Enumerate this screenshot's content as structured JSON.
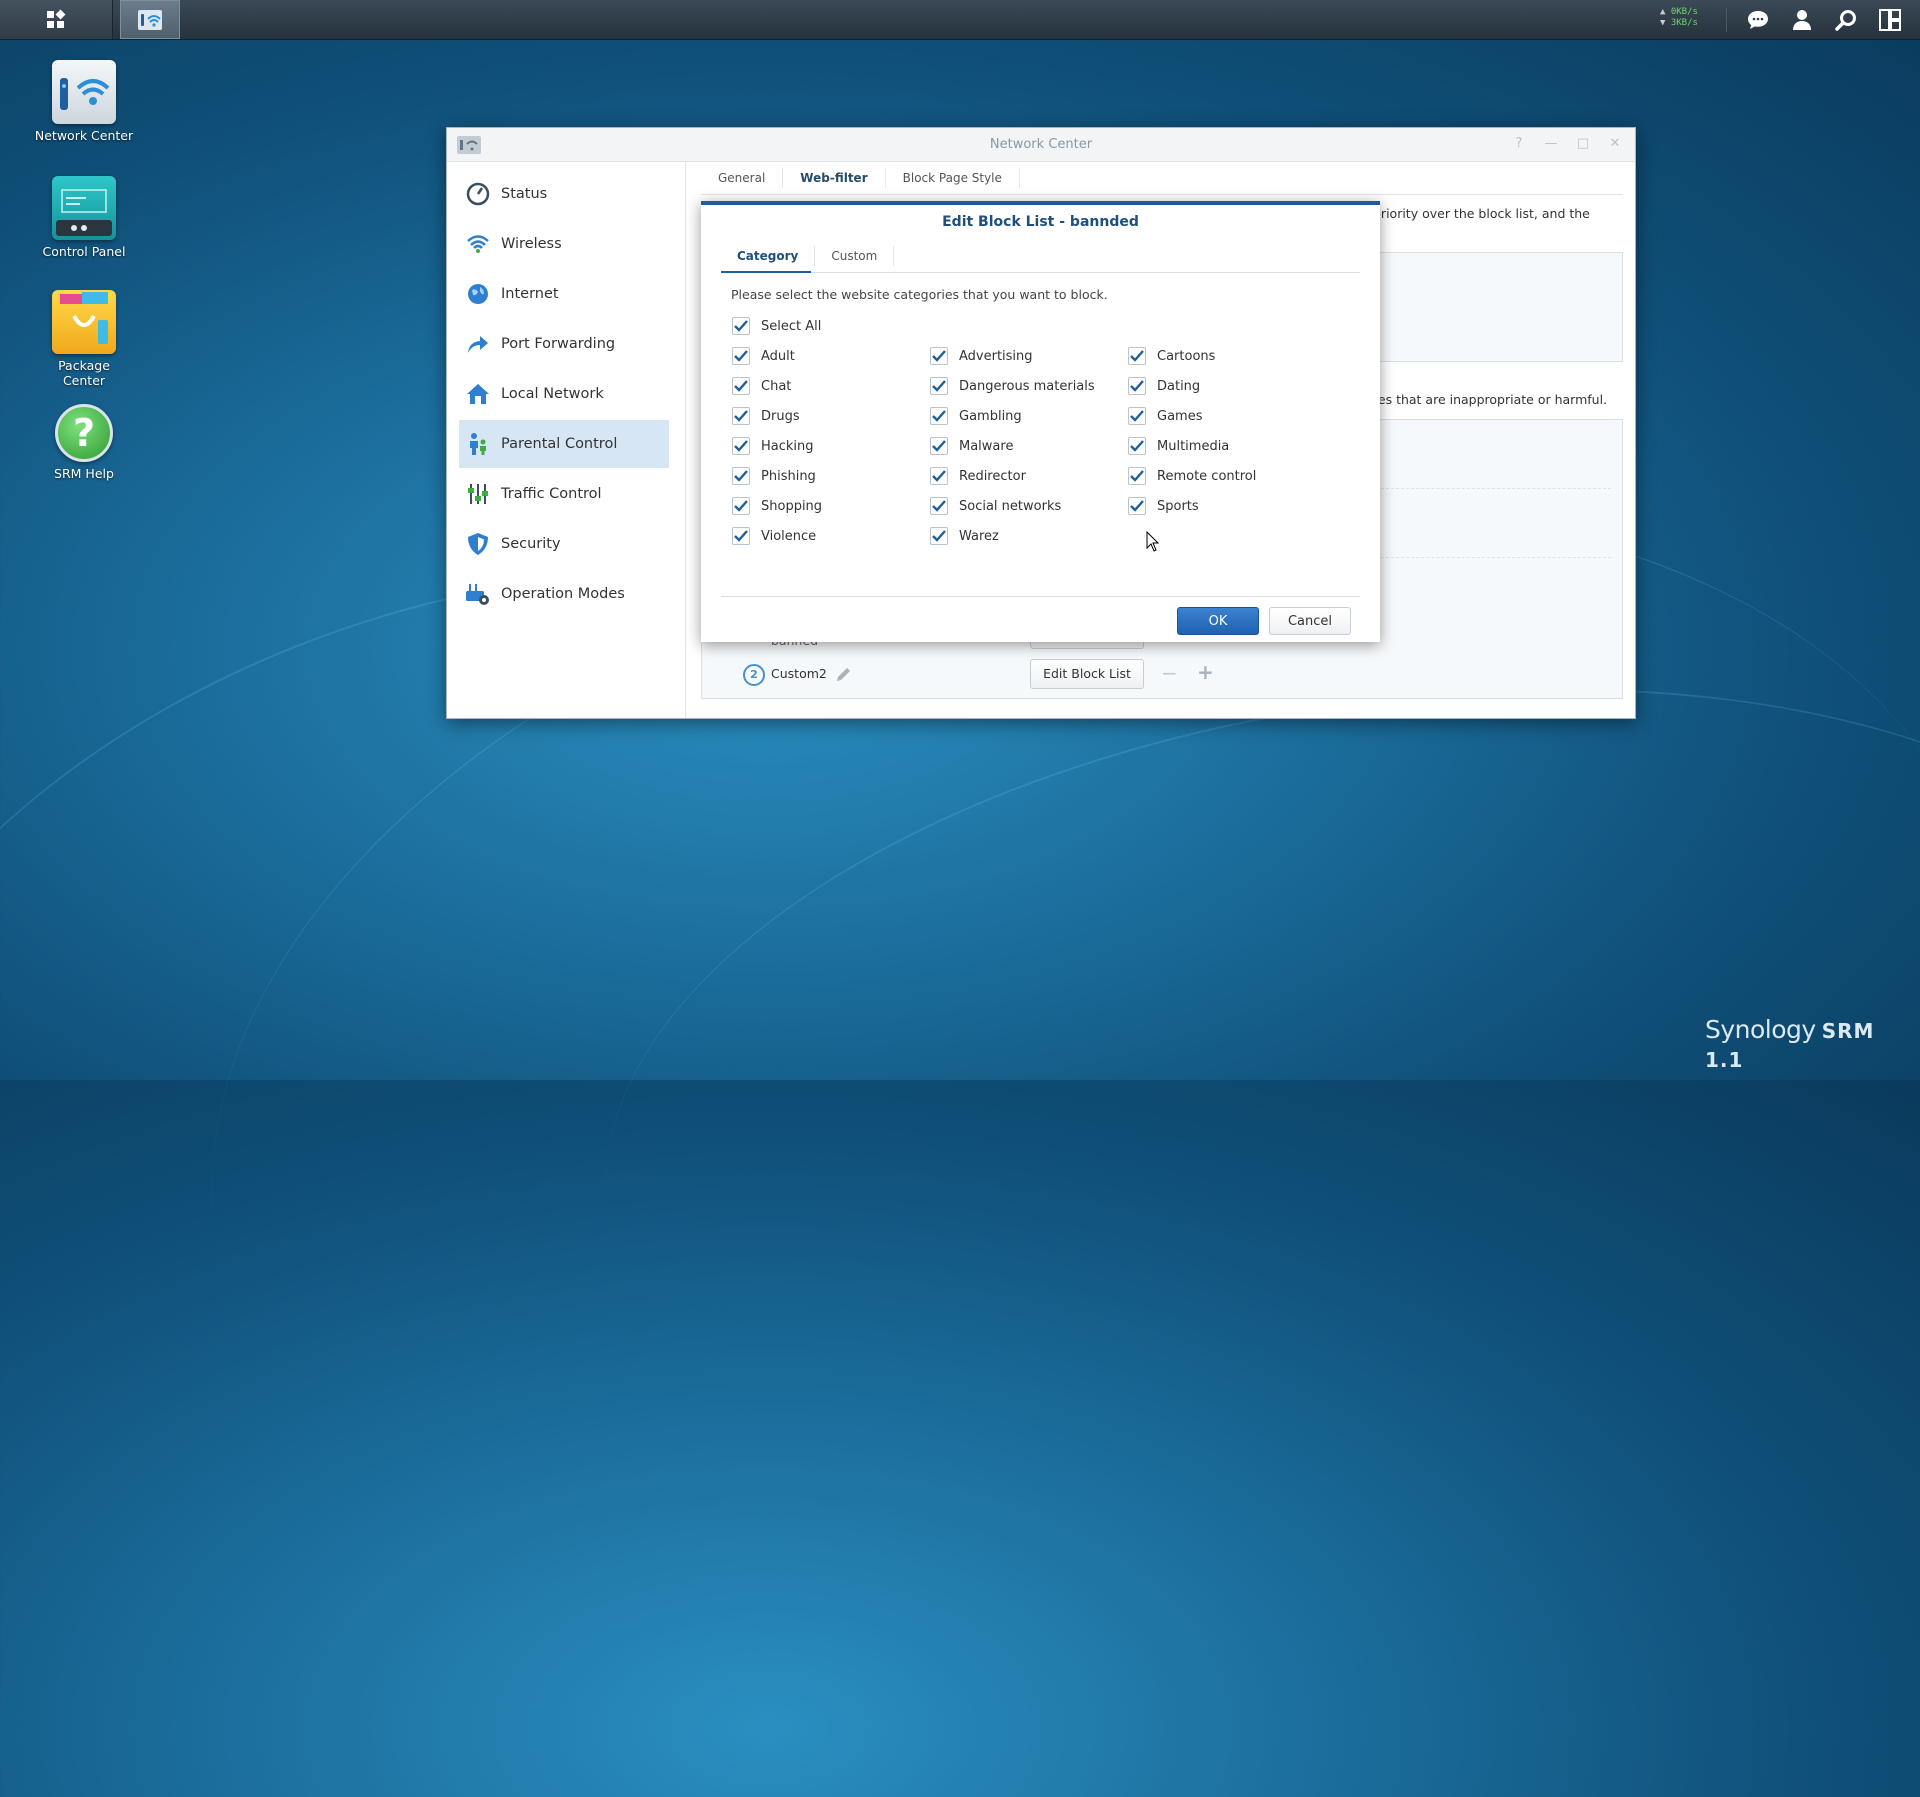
{
  "taskbar": {
    "net_up": "0KB/s",
    "net_down": "3KB/s",
    "icons": [
      "grid-icon",
      "network-center-icon",
      "chat-icon",
      "user-icon",
      "search-icon",
      "widgets-icon"
    ]
  },
  "desktop": {
    "icons": [
      {
        "label": "Network Center"
      },
      {
        "label": "Control Panel"
      },
      {
        "label": "Package Center"
      },
      {
        "label": "SRM Help"
      }
    ]
  },
  "window": {
    "title": "Network Center",
    "sidebar": [
      {
        "label": "Status",
        "icon": "gauge-icon"
      },
      {
        "label": "Wireless",
        "icon": "wifi-icon"
      },
      {
        "label": "Internet",
        "icon": "globe-icon"
      },
      {
        "label": "Port Forwarding",
        "icon": "arrow-forward-icon"
      },
      {
        "label": "Local Network",
        "icon": "house-icon"
      },
      {
        "label": "Parental Control",
        "icon": "family-icon",
        "active": true
      },
      {
        "label": "Traffic Control",
        "icon": "sliders-icon"
      },
      {
        "label": "Security",
        "icon": "shield-icon"
      },
      {
        "label": "Operation Modes",
        "icon": "router-gear-icon"
      }
    ],
    "tabs": [
      {
        "label": "General"
      },
      {
        "label": "Web-filter",
        "active": true
      },
      {
        "label": "Block Page Style"
      }
    ],
    "background": {
      "text_priority": "priority over the block list, and the",
      "text_harmful": "tes that are inappropriate or harmful.",
      "row1_name": "banned",
      "row2_num": "2",
      "row2_name": "Custom2",
      "edit_block_list": "Edit Block List"
    }
  },
  "modal": {
    "title": "Edit Block List - bannded",
    "tabs": [
      {
        "label": "Category",
        "active": true
      },
      {
        "label": "Custom"
      }
    ],
    "description": "Please select the website categories that you want to block.",
    "select_all": "Select All",
    "categories": [
      [
        "Adult",
        "Advertising",
        "Cartoons"
      ],
      [
        "Chat",
        "Dangerous materials",
        "Dating"
      ],
      [
        "Drugs",
        "Gambling",
        "Games"
      ],
      [
        "Hacking",
        "Malware",
        "Multimedia"
      ],
      [
        "Phishing",
        "Redirector",
        "Remote control"
      ],
      [
        "Shopping",
        "Social networks",
        "Sports"
      ],
      [
        "Violence",
        "Warez",
        ""
      ]
    ],
    "ok": "OK",
    "cancel": "Cancel"
  },
  "brand": {
    "name": "Synology",
    "product": "SRM 1.1"
  },
  "colors": {
    "accent": "#1c5d9c",
    "checkmark": "#1f5f9e",
    "sidebar_active": "#d6e6f4",
    "speed_text": "#6fd36f"
  }
}
